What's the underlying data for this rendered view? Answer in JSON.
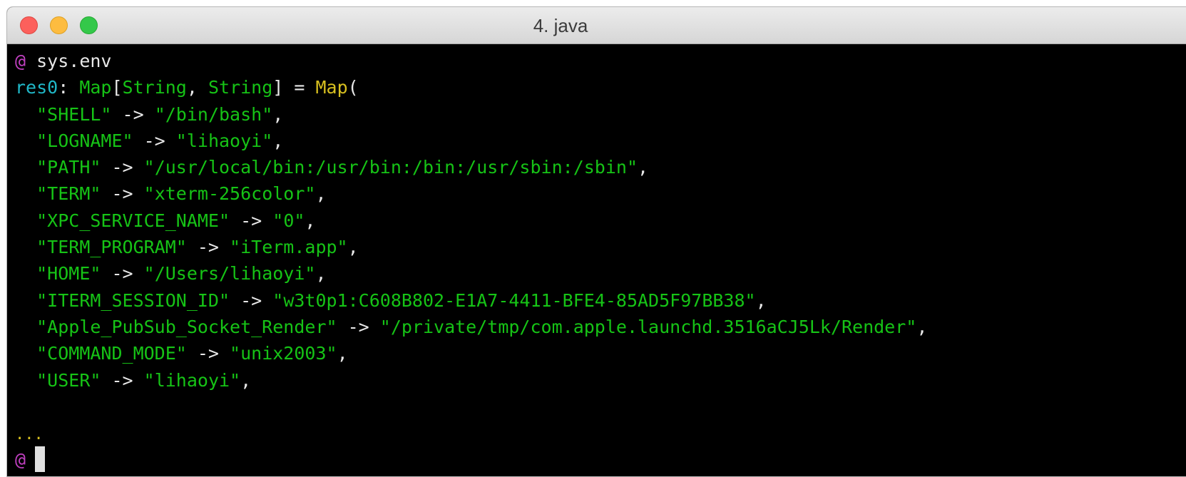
{
  "window": {
    "title": "4. java"
  },
  "terminal": {
    "prompt": "@",
    "command": "sys.env",
    "result": {
      "name": "res0",
      "colon": ": ",
      "type_outer": "Map",
      "type_open": "[",
      "type_arg1": "String",
      "type_sep": ", ",
      "type_arg2": "String",
      "type_close": "]",
      "equals": " = ",
      "ctor": "Map",
      "ctor_open": "("
    },
    "entries": [
      {
        "key": "\"SHELL\"",
        "value": "\"/bin/bash\""
      },
      {
        "key": "\"LOGNAME\"",
        "value": "\"lihaoyi\""
      },
      {
        "key": "\"PATH\"",
        "value": "\"/usr/local/bin:/usr/bin:/bin:/usr/sbin:/sbin\""
      },
      {
        "key": "\"TERM\"",
        "value": "\"xterm-256color\""
      },
      {
        "key": "\"XPC_SERVICE_NAME\"",
        "value": "\"0\""
      },
      {
        "key": "\"TERM_PROGRAM\"",
        "value": "\"iTerm.app\""
      },
      {
        "key": "\"HOME\"",
        "value": "\"/Users/lihaoyi\""
      },
      {
        "key": "\"ITERM_SESSION_ID\"",
        "value": "\"w3t0p1:C608B802-E1A7-4411-BFE4-85AD5F97BB38\""
      },
      {
        "key": "\"Apple_PubSub_Socket_Render\"",
        "value": "\"/private/tmp/com.apple.launchd.3516aCJ5Lk/Render\""
      },
      {
        "key": "\"COMMAND_MODE\"",
        "value": "\"unix2003\""
      },
      {
        "key": "\"USER\"",
        "value": "\"lihaoyi\""
      }
    ],
    "arrow": " -> ",
    "comma": ",",
    "ellipsis": "...",
    "prompt2": "@"
  },
  "colors": {
    "prompt": "#c040c0",
    "identifier": "#20b8c8",
    "string": "#16c316",
    "ellipsis": "#d8c020"
  }
}
